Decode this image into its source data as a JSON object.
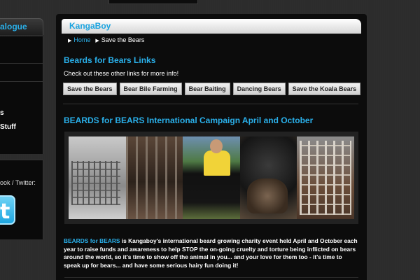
{
  "sidebar": {
    "header": "alogue",
    "items": [
      "s",
      "Stuff"
    ],
    "twitter_label": "ook / Twitter:",
    "twitter_icon": "twitter-icon"
  },
  "main": {
    "header": "KangaBoy",
    "breadcrumb": {
      "home": "Home",
      "current": "Save the Bears"
    },
    "links_title": "Beards for Bears Links",
    "links_intro": "Check out these other links for more info!",
    "link_buttons": [
      "Save the Bears",
      "Bear Bile Farming",
      "Bear Baiting",
      "Dancing Bears",
      "Save the Koala Bears"
    ],
    "campaign_title": "BEARDS for BEARS International Campaign April and October",
    "photos": [
      "bears-in-cages",
      "bear-behind-bars",
      "man-with-black-bear",
      "bear-paws",
      "caged-bears"
    ],
    "body_highlight": "BEARDS for BEARS",
    "body_text": " is Kangaboy's international beard growing charity event held April and October each year to raise funds and awareness to help STOP the on-going cruelty and torture being inflicted on bears around the world, so it's time to show off the animal in you... and your love for them too - it's time to speak up for bears... and have some serious hairy fun doing it!"
  },
  "colors": {
    "accent": "#2ab0ea",
    "panel": "#0c0c0c",
    "background": "#2c2c2c"
  }
}
